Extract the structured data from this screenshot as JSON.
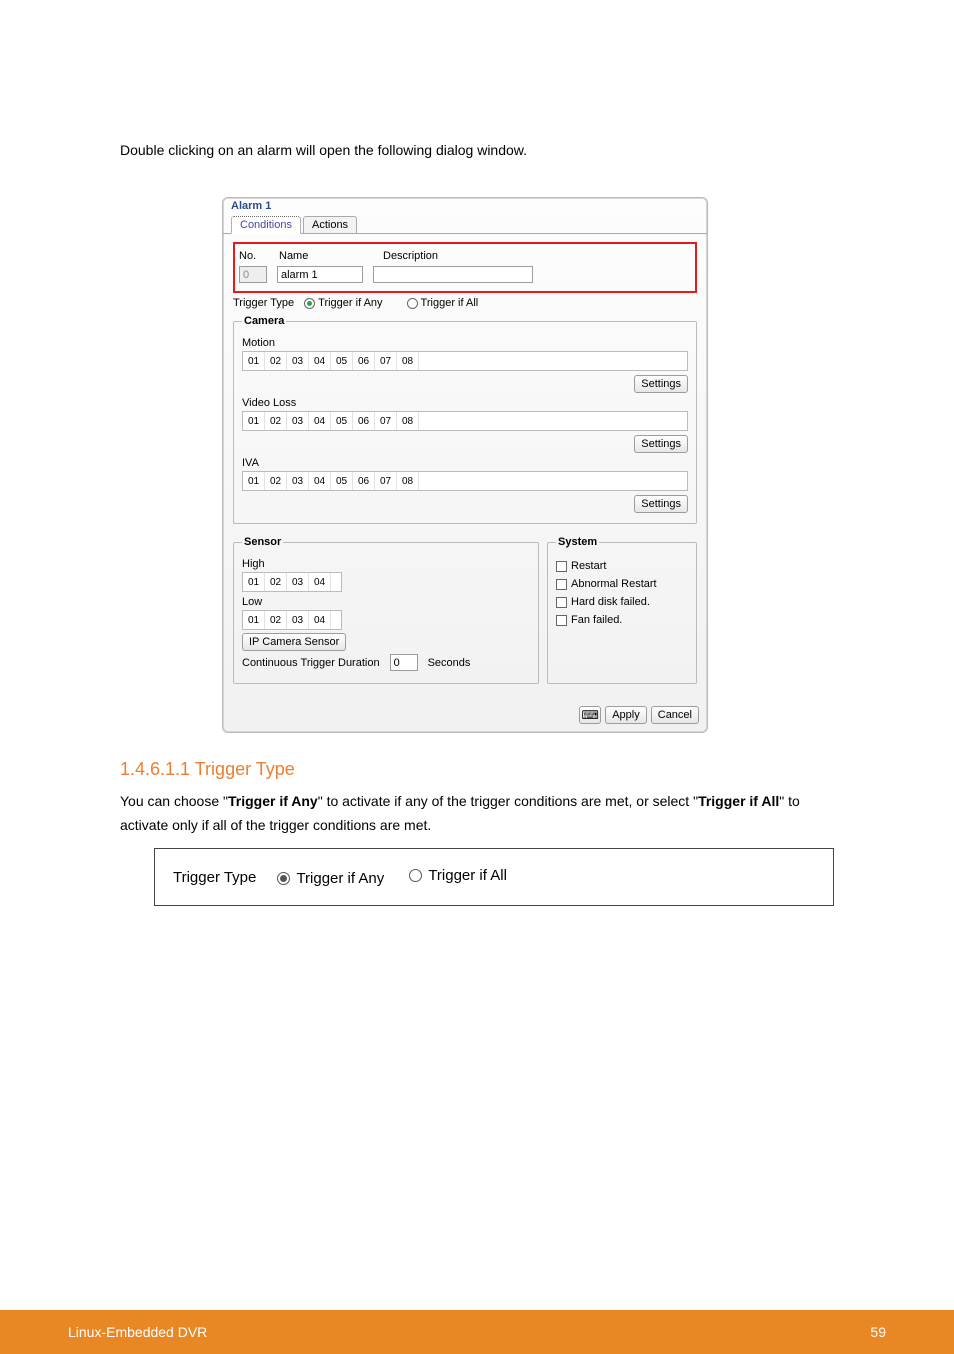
{
  "intro": "Double clicking on an alarm will open the following dialog window.",
  "dialog": {
    "title": "Alarm 1",
    "tabs": {
      "conditions": "Conditions",
      "actions": "Actions"
    },
    "fields": {
      "no_label": "No.",
      "no_value": "0",
      "name_label": "Name",
      "name_value": "alarm 1",
      "desc_label": "Description",
      "desc_value": ""
    },
    "trigger": {
      "label": "Trigger Type",
      "any": "Trigger if Any",
      "all": "Trigger if All",
      "selected": "any"
    },
    "camera": {
      "legend": "Camera",
      "motion": "Motion",
      "videoloss": "Video Loss",
      "iva": "IVA",
      "cells": [
        "01",
        "02",
        "03",
        "04",
        "05",
        "06",
        "07",
        "08"
      ],
      "settings": "Settings"
    },
    "sensor": {
      "legend": "Sensor",
      "high": "High",
      "low": "Low",
      "cells": [
        "01",
        "02",
        "03",
        "04"
      ],
      "ipcam": "IP Camera Sensor",
      "ctd_label": "Continuous Trigger Duration",
      "ctd_value": "0",
      "ctd_unit": "Seconds"
    },
    "system": {
      "legend": "System",
      "items": [
        "Restart",
        "Abnormal Restart",
        "Hard disk failed.",
        "Fan failed."
      ]
    },
    "buttons": {
      "apply": "Apply",
      "cancel": "Cancel"
    }
  },
  "section_heading": "1.4.6.1.1 Trigger Type",
  "body1_parts": {
    "pre": "You can choose \"",
    "bold1": "Trigger if Any",
    "mid1": "\" to activate if any of the trigger conditions are met, or select \"",
    "bold2": "Trigger if All",
    "post": "\" to activate only if all of the trigger conditions are met."
  },
  "inset_trigger": {
    "label": "Trigger Type",
    "any": "Trigger if Any",
    "all": "Trigger if All"
  },
  "footer": {
    "title": "Linux-Embedded DVR",
    "page": "59"
  }
}
